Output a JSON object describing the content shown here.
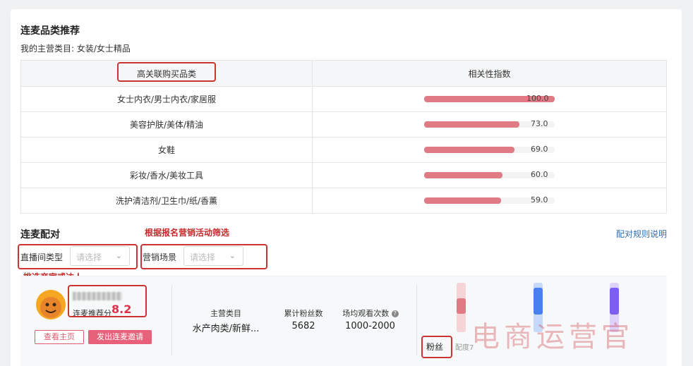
{
  "section1": {
    "title": "连麦品类推荐",
    "category_line": "我的主营类目: 女装/女士精品"
  },
  "table": {
    "headers": [
      "高关联购买品类",
      "相关性指数"
    ],
    "rows": [
      {
        "category": "女士内衣/男士内衣/家居服",
        "value": 100.0,
        "label": "100.0"
      },
      {
        "category": "美容护肤/美体/精油",
        "value": 73.0,
        "label": "73.0"
      },
      {
        "category": "女鞋",
        "value": 69.0,
        "label": "69.0"
      },
      {
        "category": "彩妆/香水/美妆工具",
        "value": 60.0,
        "label": "60.0"
      },
      {
        "category": "洗护清洁剂/卫生巾/纸/香薰",
        "value": 59.0,
        "label": "59.0"
      }
    ],
    "bar_color": "#e07b86"
  },
  "section2": {
    "title": "连麦配对",
    "annotation_filter": "根据报名营销活动筛选",
    "rules_link": "配对规则说明",
    "filter1_label": "直播间类型",
    "filter1_placeholder": "请选择",
    "filter2_label": "营销场景",
    "filter2_placeholder": "请选择",
    "annotation_pick": "挑选商家或达人"
  },
  "card": {
    "recommend_label": "连麦推荐分",
    "recommend_score": "8.2",
    "view_home": "查看主页",
    "send_invite": "发出连麦邀请",
    "main_category_label": "主营类目",
    "main_category_value": "水产肉类/新鲜...",
    "fans_label": "累计粉丝数",
    "fans_value": "5682",
    "views_label": "场均观看次数",
    "views_value": "1000-2000",
    "fans_tag": "粉丝",
    "fans_tag_rest": "配度7",
    "watermark": "电商运营官"
  },
  "colors": {
    "accent_red": "#c33",
    "brand_pink": "#e8607a",
    "link_blue": "#2e6fb5"
  }
}
